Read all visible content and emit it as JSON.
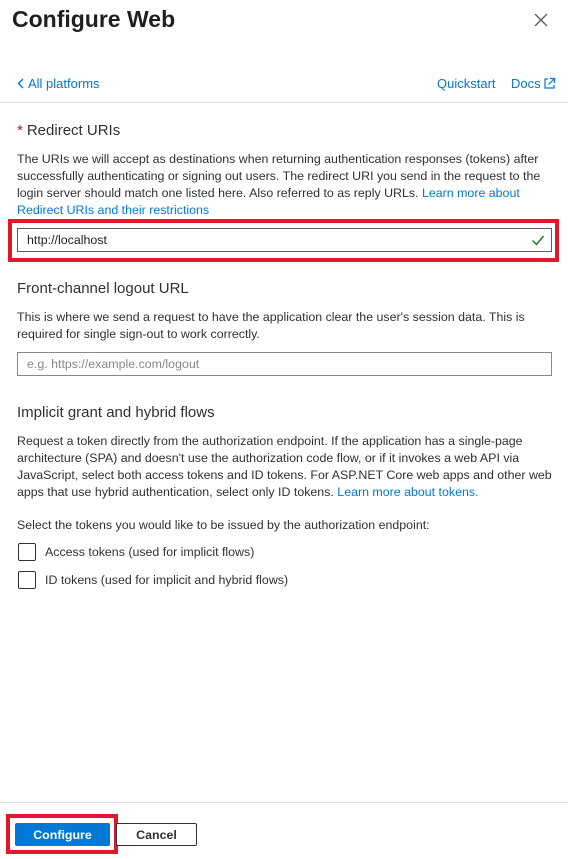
{
  "panel": {
    "title": "Configure Web",
    "close_icon": "close-icon"
  },
  "nav": {
    "back_label": "All platforms",
    "quickstart_label": "Quickstart",
    "docs_label": "Docs",
    "external_icon": "external-link-icon"
  },
  "redirect": {
    "required_mark": "*",
    "title": "Redirect URIs",
    "description": "The URIs we will accept as destinations when returning authentication responses (tokens) after successfully authenticating or signing out users. The redirect URI you send in the request to the login server should match one listed here. Also referred to as reply URLs.",
    "link": "Learn more about Redirect URIs and their restrictions",
    "value": "http://localhost",
    "valid_icon": "checkmark-icon"
  },
  "logout": {
    "title": "Front-channel logout URL",
    "description": "This is where we send a request to have the application clear the user's session data. This is required for single sign-out to work correctly.",
    "placeholder": "e.g. https://example.com/logout"
  },
  "implicit": {
    "title": "Implicit grant and hybrid flows",
    "description": "Request a token directly from the authorization endpoint. If the application has a single-page architecture (SPA) and doesn't use the authorization code flow, or if it invokes a web API via JavaScript, select both access tokens and ID tokens. For ASP.NET Core web apps and other web apps that use hybrid authentication, select only ID tokens.",
    "link": "Learn more about tokens.",
    "select_prompt": "Select the tokens you would like to be issued by the authorization endpoint:",
    "options": [
      {
        "label": "Access tokens (used for implicit flows)",
        "checked": false
      },
      {
        "label": "ID tokens (used for implicit and hybrid flows)",
        "checked": false
      }
    ]
  },
  "footer": {
    "configure_label": "Configure",
    "cancel_label": "Cancel"
  },
  "colors": {
    "accent": "#0078d4",
    "highlight": "#e0192a",
    "valid": "#107c10",
    "required": "#a4262c"
  }
}
